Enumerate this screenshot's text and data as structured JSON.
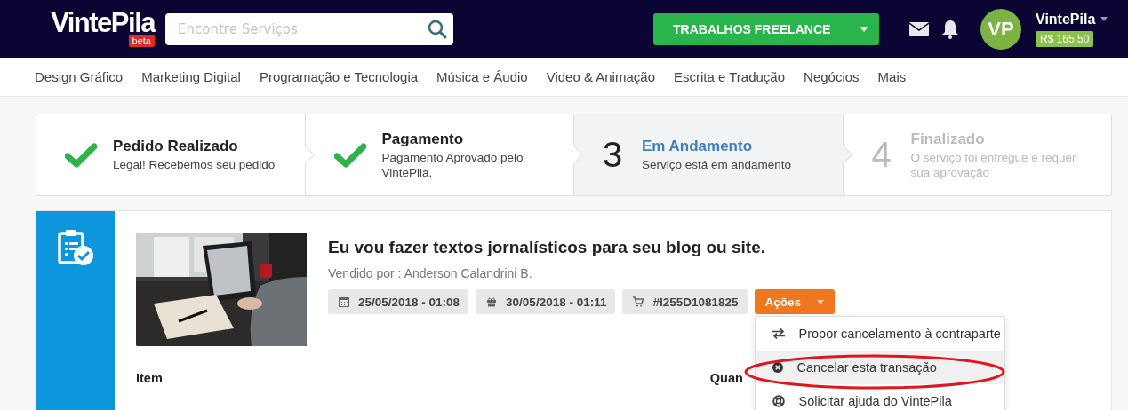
{
  "header": {
    "logo": "VintePila",
    "logo_badge": "beta",
    "search": {
      "placeholder": "Encontre Serviços"
    },
    "freelance_button": "TRABALHOS FREELANCE",
    "avatar_initials": "VP",
    "username": "VintePila",
    "balance": "R$ 165,50"
  },
  "categories": [
    "Design Gráfico",
    "Marketing Digital",
    "Programação e Tecnologia",
    "Música e Áudio",
    "Video & Animação",
    "Escrita e Tradução",
    "Negócios",
    "Mais"
  ],
  "steps": [
    {
      "kind": "done",
      "title": "Pedido Realizado",
      "description": "Legal! Recebemos seu pedido"
    },
    {
      "kind": "done",
      "title": "Pagamento",
      "description": "Pagamento Aprovado pelo VintePila."
    },
    {
      "kind": "current",
      "number": "3",
      "title": "Em Andamento",
      "description": "Serviço está em andamento"
    },
    {
      "kind": "pending",
      "number": "4",
      "title": "Finalizado",
      "description": "O serviço foi entregue e requer sua aprovação"
    }
  ],
  "order": {
    "title": "Eu vou fazer textos jornalísticos para seu blog ou site.",
    "seller": "Vendido por : Anderson Calandrini B.",
    "chips": [
      {
        "kind": "calendar",
        "text": "25/05/2018 - 01:08"
      },
      {
        "kind": "gift",
        "text": "30/05/2018 - 01:11"
      },
      {
        "kind": "cart",
        "text": "#I255D1081825"
      }
    ],
    "actions_button": "Ações",
    "actions_menu": [
      {
        "kind": "swap",
        "label": "Propor cancelamento à contraparte",
        "selected": false
      },
      {
        "kind": "cancel",
        "label": "Cancelar esta transação",
        "selected": true
      },
      {
        "kind": "help",
        "label": "Solicitar ajuda do VintePila",
        "selected": false
      }
    ],
    "table": {
      "columns": [
        "Item",
        "Quan"
      ]
    }
  }
}
